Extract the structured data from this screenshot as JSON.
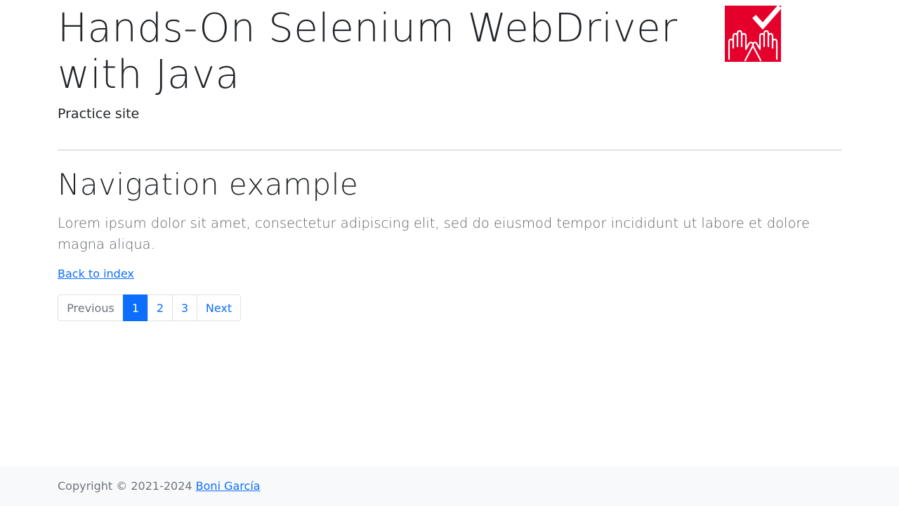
{
  "header": {
    "title": "Hands-On Selenium WebDriver with Java",
    "subtitle": "Practice site",
    "logo_icon": "selenium-hands-check-logo",
    "logo_color": "#e5002b"
  },
  "main": {
    "heading": "Navigation example",
    "lead": "Lorem ipsum dolor sit amet, consectetur adipiscing elit, sed do eiusmod tempor incididunt ut labore et dolore magna aliqua.",
    "back_link": "Back to index",
    "pagination": {
      "previous": "Previous",
      "pages": [
        "1",
        "2",
        "3"
      ],
      "active_page": "1",
      "next": "Next",
      "active_color": "#0d6efd"
    }
  },
  "footer": {
    "copyright": "Copyright © 2021-2024",
    "author": "Boni García"
  }
}
